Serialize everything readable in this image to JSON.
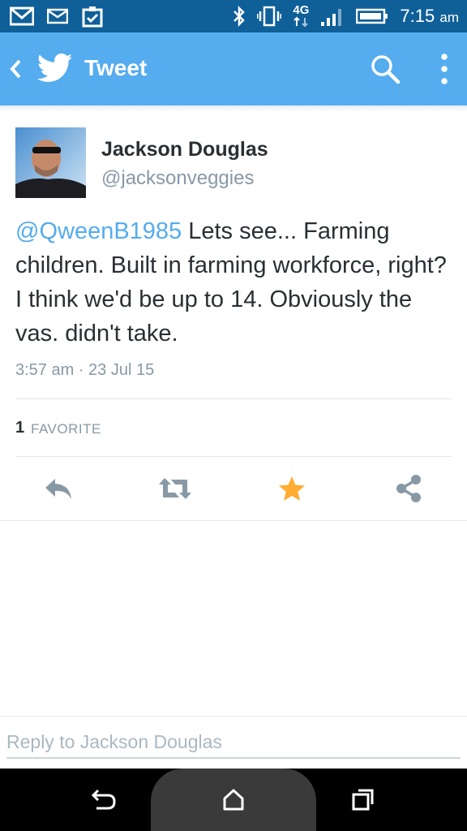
{
  "status_bar": {
    "network_type": "4G",
    "time": "7:15",
    "time_suffix": "am",
    "icons": [
      "gmail-icon",
      "email-icon",
      "clipboard-check-icon",
      "bluetooth-icon",
      "vibrate-icon",
      "network-4g-icon",
      "signal-icon",
      "battery-icon"
    ]
  },
  "app_bar": {
    "title": "Tweet",
    "color": "#55acee"
  },
  "tweet": {
    "author_name": "Jackson Douglas",
    "author_handle": "@jacksonveggies",
    "mention": "@QweenB1985",
    "text_after_mention": " Lets see... Farming children.  Built in farming workforce, right?  I think we'd be up to 14.  Obviously the vas. didn't take.",
    "timestamp": "3:57 am · 23 Jul 15",
    "favorite_count": "1",
    "favorite_label": "FAVORITE"
  },
  "actions": {
    "reply": "reply-icon",
    "retweet": "retweet-icon",
    "favorite": "star-icon",
    "favorite_color": "#ffac33",
    "share": "share-icon"
  },
  "reply": {
    "placeholder": "Reply to Jackson Douglas"
  },
  "nav": {
    "icons": [
      "back-nav-icon",
      "home-nav-icon",
      "recents-nav-icon"
    ]
  }
}
